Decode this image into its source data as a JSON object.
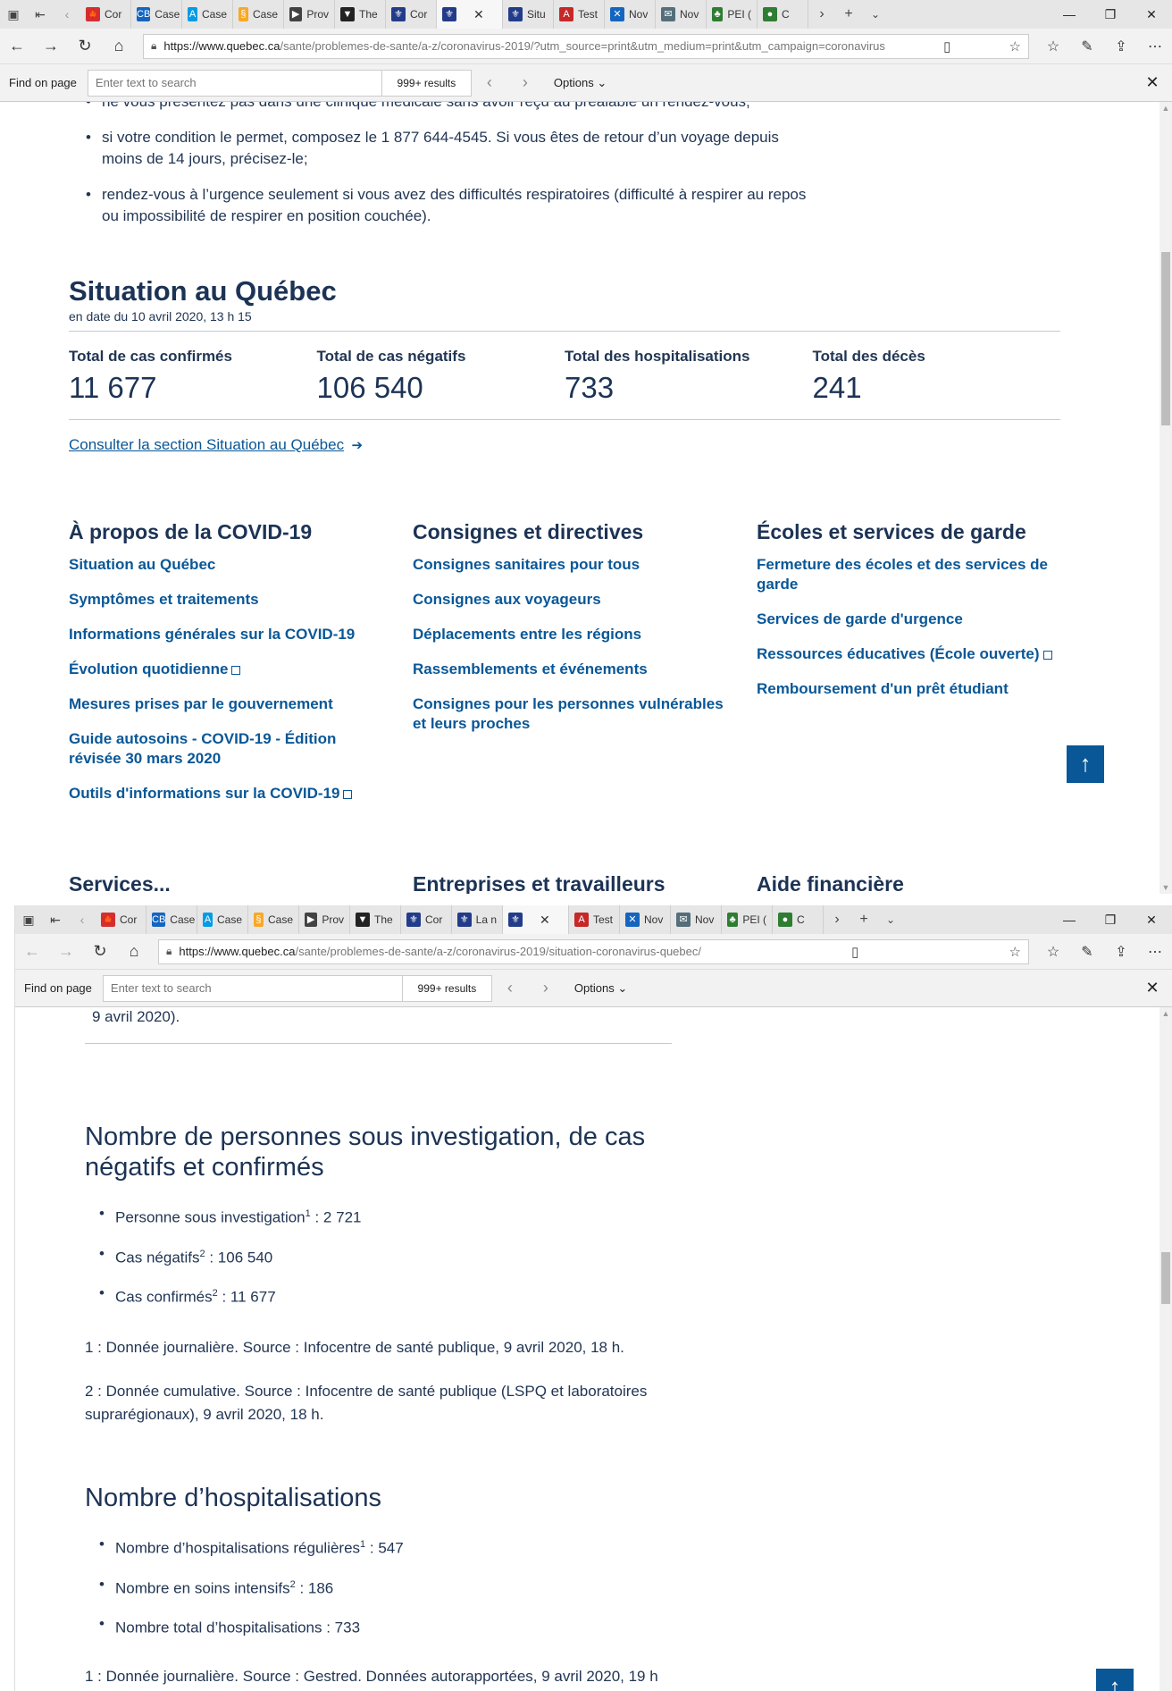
{
  "window1": {
    "tabs": [
      {
        "label": "Cor",
        "color": "#d32f2f",
        "glyph": "🍁"
      },
      {
        "label": "Case",
        "color": "#1565c0",
        "glyph": "CB"
      },
      {
        "label": "Case",
        "color": "#039be5",
        "glyph": "A"
      },
      {
        "label": "Case",
        "color": "#f9a825",
        "glyph": "§"
      },
      {
        "label": "Prov",
        "color": "#424242",
        "glyph": "▶"
      },
      {
        "label": "The",
        "color": "#222222",
        "glyph": "▼"
      },
      {
        "label": "Cor",
        "color": "#223c8a",
        "glyph": "⚜"
      },
      {
        "label": "",
        "color": "#223c8a",
        "glyph": "⚜",
        "active": true
      },
      {
        "label": "Situ",
        "color": "#223c8a",
        "glyph": "⚜"
      },
      {
        "label": "Test",
        "color": "#c62828",
        "glyph": "A"
      },
      {
        "label": "Nov",
        "color": "#1565c0",
        "glyph": "✕"
      },
      {
        "label": "Nov",
        "color": "#546e7a",
        "glyph": "✉"
      },
      {
        "label": "PEI (",
        "color": "#2e7d32",
        "glyph": "♣"
      },
      {
        "label": "C",
        "color": "#2e7d32",
        "glyph": "●"
      }
    ],
    "url_host": "https://www.quebec.ca",
    "url_path": "/sante/problemes-de-sante/a-z/coronavirus-2019/?utm_source=print&utm_medium=print&utm_campaign=coronavirus",
    "find": {
      "label": "Find on page",
      "placeholder": "Enter text to search",
      "results": "999+ results",
      "options": "Options"
    },
    "bullets": [
      "ne vous présentez pas dans une clinique médicale sans avoir reçu au préalable un rendez-vous;",
      "si votre condition le permet, composez le 1 877 644-4545. Si vous êtes de retour d’un voyage depuis moins de 14 jours, précisez-le;",
      "rendez-vous à l’urgence seulement si vous avez des difficultés respiratoires (difficulté à respirer au repos ou impossibilité de respirer en position couchée)."
    ],
    "situation": {
      "title": "Situation au Québec",
      "date": "en date du 10 avril 2020, 13 h 15",
      "stats": [
        {
          "label": "Total de cas confirmés",
          "value": "11 677"
        },
        {
          "label": "Total de cas négatifs",
          "value": "106 540"
        },
        {
          "label": "Total des hospitalisations",
          "value": "733"
        },
        {
          "label": "Total des décès",
          "value": "241"
        }
      ],
      "link": "Consulter la section Situation au Québec"
    },
    "columns": [
      {
        "title": "À propos de la COVID-19",
        "links": [
          {
            "text": "Situation au Québec"
          },
          {
            "text": "Symptômes et traitements"
          },
          {
            "text": "Informations générales sur la COVID-19"
          },
          {
            "text": "Évolution quotidienne",
            "ext": true
          },
          {
            "text": "Mesures prises par le gouvernement"
          },
          {
            "text": "Guide autosoins - COVID-19 - Édition révisée 30 mars 2020"
          },
          {
            "text": "Outils d'informations sur la COVID-19",
            "ext": true
          }
        ]
      },
      {
        "title": "Consignes et directives",
        "links": [
          {
            "text": "Consignes sanitaires pour tous"
          },
          {
            "text": "Consignes aux voyageurs"
          },
          {
            "text": "Déplacements entre les régions"
          },
          {
            "text": "Rassemblements et événements"
          },
          {
            "text": "Consignes pour les personnes vulnérables et leurs proches"
          }
        ]
      },
      {
        "title": "Écoles et services de garde",
        "links": [
          {
            "text": "Fermeture des écoles et des services de garde"
          },
          {
            "text": "Services de garde d'urgence"
          },
          {
            "text": "Ressources éducatives (École ouverte)",
            "ext": true
          },
          {
            "text": "Remboursement d'un prêt étudiant"
          }
        ]
      }
    ],
    "cut_headings": [
      "Services...",
      "Entreprises et travailleurs",
      "Aide financière"
    ]
  },
  "window2": {
    "tabs": [
      {
        "label": "Cor",
        "color": "#d32f2f",
        "glyph": "🍁"
      },
      {
        "label": "Case",
        "color": "#1565c0",
        "glyph": "CB"
      },
      {
        "label": "Case",
        "color": "#039be5",
        "glyph": "A"
      },
      {
        "label": "Case",
        "color": "#f9a825",
        "glyph": "§"
      },
      {
        "label": "Prov",
        "color": "#424242",
        "glyph": "▶"
      },
      {
        "label": "The",
        "color": "#222222",
        "glyph": "▼"
      },
      {
        "label": "Cor",
        "color": "#223c8a",
        "glyph": "⚜"
      },
      {
        "label": "La n",
        "color": "#223c8a",
        "glyph": "⚜"
      },
      {
        "label": "",
        "color": "#223c8a",
        "glyph": "⚜",
        "active": true
      },
      {
        "label": "Test",
        "color": "#c62828",
        "glyph": "A"
      },
      {
        "label": "Nov",
        "color": "#1565c0",
        "glyph": "✕"
      },
      {
        "label": "Nov",
        "color": "#546e7a",
        "glyph": "✉"
      },
      {
        "label": "PEI (",
        "color": "#2e7d32",
        "glyph": "♣"
      },
      {
        "label": "C",
        "color": "#2e7d32",
        "glyph": "●"
      }
    ],
    "url_host": "https://www.quebec.ca",
    "url_path": "/sante/problemes-de-sante/a-z/coronavirus-2019/situation-coronavirus-quebec/",
    "find": {
      "label": "Find on page",
      "placeholder": "Enter text to search",
      "results": "999+ results",
      "options": "Options"
    },
    "top_text": "9 avril 2020).",
    "section1": {
      "title": "Nombre de personnes sous investigation, de cas négatifs et confirmés",
      "items": [
        {
          "label": "Personne sous investigation",
          "sup": "1",
          "value": " : 2 721"
        },
        {
          "label": "Cas négatifs",
          "sup": "2",
          "value": " : 106 540"
        },
        {
          "label": "Cas confirmés",
          "sup": "2",
          "value": " : 11 677"
        }
      ],
      "note1": "1 : Donnée journalière. Source : Infocentre de santé publique, 9 avril 2020, 18 h.",
      "note2": "2 : Donnée cumulative. Source : Infocentre de santé publique (LSPQ et laboratoires suprarégionaux), 9 avril 2020, 18 h."
    },
    "section2": {
      "title": "Nombre d’hospitalisations",
      "items": [
        {
          "label": "Nombre d’hospitalisations régulières",
          "sup": "1",
          "value": " : 547"
        },
        {
          "label": "Nombre en soins intensifs",
          "sup": "2",
          "value": " : 186"
        },
        {
          "label": "Nombre total d’hospitalisations",
          "sup": "",
          "value": " : 733"
        }
      ],
      "note1": "1 : Donnée journalière. Source : Gestred. Données autorapportées, 9 avril 2020, 19 h"
    }
  }
}
